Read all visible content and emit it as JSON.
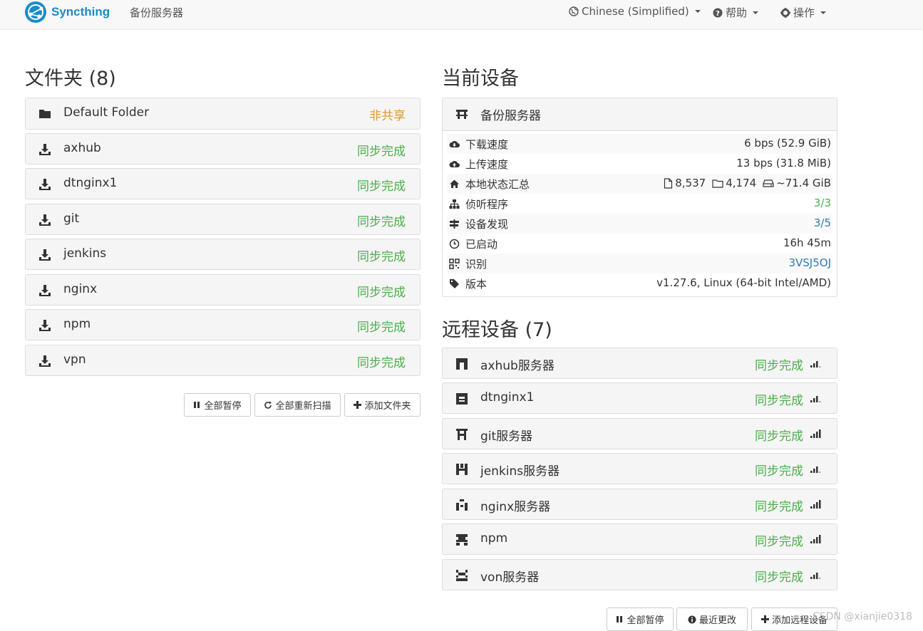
{
  "navbar": {
    "brand": "Syncthing",
    "device_name": "备份服务器",
    "language": "Chinese (Simplified)",
    "help": "帮助",
    "actions": "操作"
  },
  "folders": {
    "heading": "文件夹 (8)",
    "items": [
      {
        "name": "Default Folder",
        "status": "非共享",
        "status_color": "#e09a2f",
        "icon": "folder-icon"
      },
      {
        "name": "axhub",
        "status": "同步完成",
        "status_color": "#4cae4c",
        "icon": "download-icon"
      },
      {
        "name": "dtnginx1",
        "status": "同步完成",
        "status_color": "#4cae4c",
        "icon": "download-icon"
      },
      {
        "name": "git",
        "status": "同步完成",
        "status_color": "#4cae4c",
        "icon": "download-icon"
      },
      {
        "name": "jenkins",
        "status": "同步完成",
        "status_color": "#4cae4c",
        "icon": "download-icon"
      },
      {
        "name": "nginx",
        "status": "同步完成",
        "status_color": "#4cae4c",
        "icon": "download-icon"
      },
      {
        "name": "npm",
        "status": "同步完成",
        "status_color": "#4cae4c",
        "icon": "download-icon"
      },
      {
        "name": "vpn",
        "status": "同步完成",
        "status_color": "#4cae4c",
        "icon": "download-icon"
      }
    ],
    "buttons": {
      "pause_all": "全部暂停",
      "rescan_all": "全部重新扫描",
      "add_folder": "添加文件夹"
    }
  },
  "this_device": {
    "heading": "当前设备",
    "name": "备份服务器",
    "rows": [
      {
        "label": "下载速度",
        "value": "6 bps (52.9 GiB)",
        "icon": "cloud-download-icon"
      },
      {
        "label": "上传速度",
        "value": "13 bps (31.8 MiB)",
        "icon": "cloud-upload-icon"
      },
      {
        "label": "本地状态汇总",
        "files": "8,537",
        "dirs": "4,174",
        "size": "~71.4 GiB",
        "icon": "home-icon"
      },
      {
        "label": "侦听程序",
        "value": "3/3",
        "icon": "sitemap-icon",
        "value_color": "#4cae4c"
      },
      {
        "label": "设备发现",
        "value": "3/5",
        "icon": "signpost-icon",
        "value_color": "#337ab7"
      },
      {
        "label": "已启动",
        "value": "16h 45m",
        "icon": "clock-icon"
      },
      {
        "label": "识别",
        "value": "3VSJ5OJ",
        "icon": "qrcode-icon",
        "value_color": "#337ab7"
      },
      {
        "label": "版本",
        "value": "v1.27.6, Linux (64-bit Intel/AMD)",
        "icon": "tag-icon"
      }
    ]
  },
  "remote_devices": {
    "heading": "远程设备 (7)",
    "items": [
      {
        "name": "axhub服务器",
        "status": "同步完成",
        "signal": 3
      },
      {
        "name": "dtnginx1",
        "status": "同步完成",
        "signal": 3
      },
      {
        "name": "git服务器",
        "status": "同步完成",
        "signal": 4
      },
      {
        "name": "jenkins服务器",
        "status": "同步完成",
        "signal": 3
      },
      {
        "name": "nginx服务器",
        "status": "同步完成",
        "signal": 4
      },
      {
        "name": "npm",
        "status": "同步完成",
        "signal": 4
      },
      {
        "name": "von服务器",
        "status": "同步完成",
        "signal": 3
      }
    ],
    "buttons": {
      "pause_all": "全部暂停",
      "recent_changes": "最近更改",
      "add_device": "添加远程设备"
    }
  },
  "watermark": "CSDN @xianjie0318"
}
